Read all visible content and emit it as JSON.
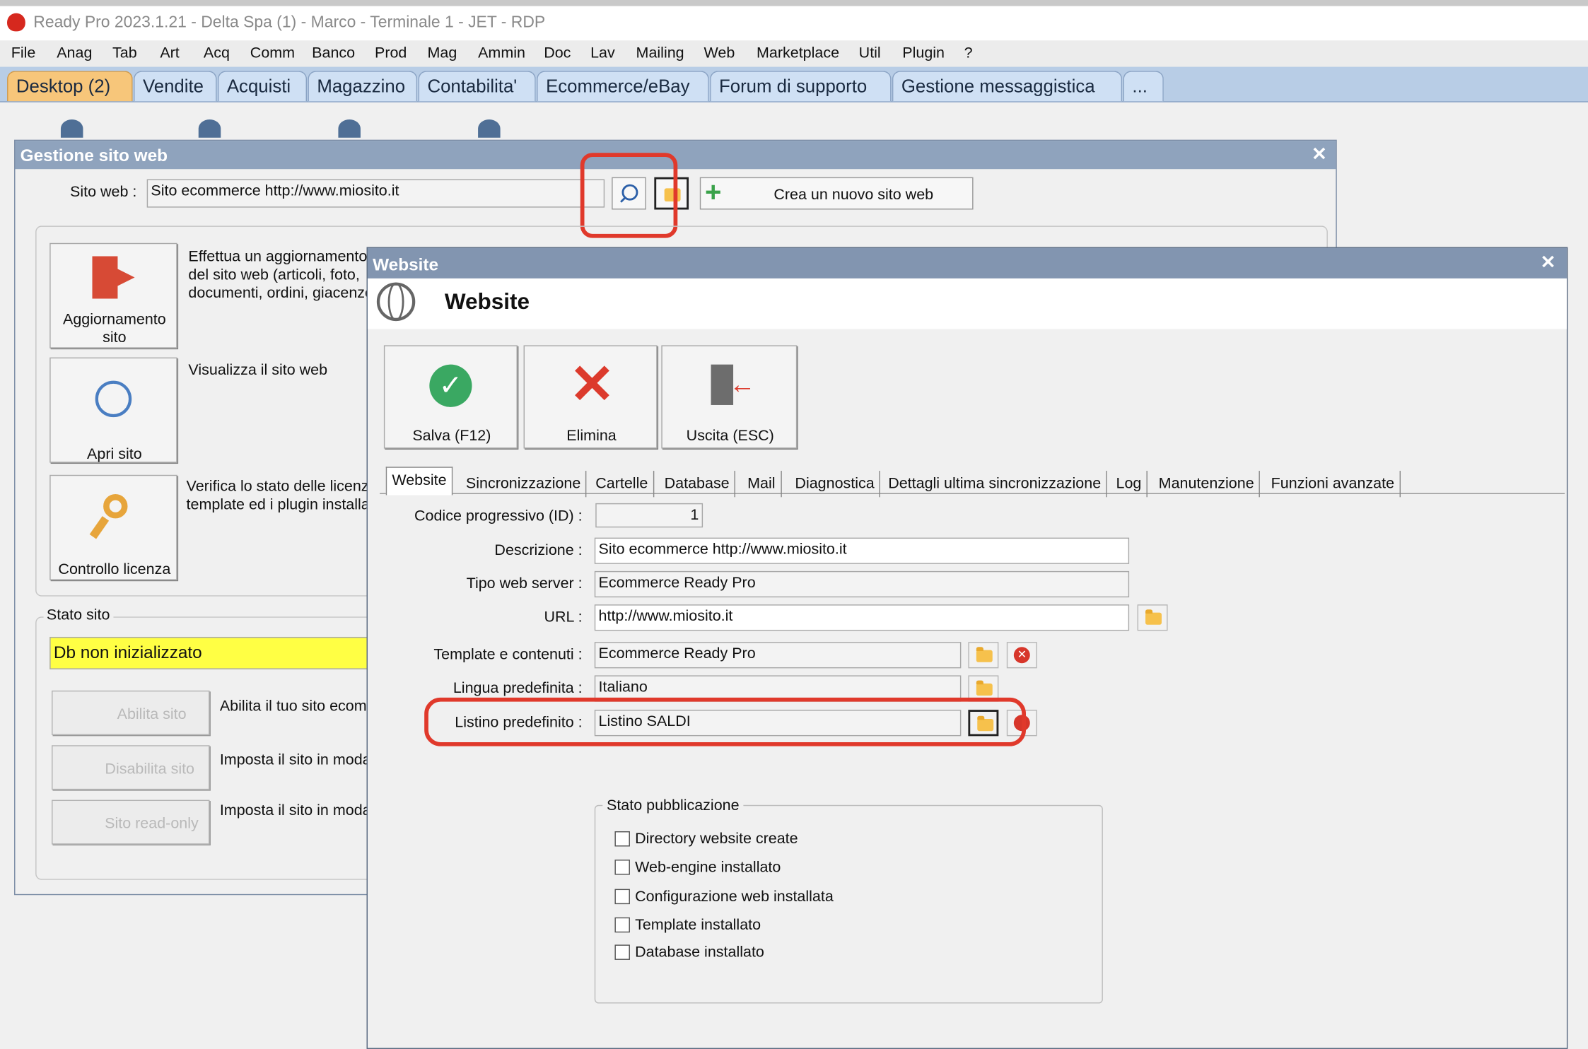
{
  "app": {
    "title": "Ready Pro 2023.1.21 - Delta Spa (1) - Marco - Terminale 1 - JET - RDP"
  },
  "menu": [
    "File",
    "Anag",
    "Tab",
    "Art",
    "Acq",
    "Comm",
    "Banco",
    "Prod",
    "Mag",
    "Ammin",
    "Doc",
    "Lav",
    "Mailing",
    "Web",
    "Marketplace",
    "Util",
    "Plugin",
    "?"
  ],
  "tabs": [
    "Desktop (2)",
    "Vendite",
    "Acquisti",
    "Magazzino",
    "Contabilita'",
    "Ecommerce/eBay",
    "Forum di supporto",
    "Gestione messaggistica",
    "..."
  ],
  "gestione": {
    "title": "Gestione sito web",
    "sito_label": "Sito web :",
    "sito_value": "Sito ecommerce http://www.miosito.it",
    "crea_label": "Crea un nuovo sito web",
    "aggiorna_label_1": "Aggiornamento",
    "aggiorna_label_2": "sito",
    "aggiorna_desc_1": "Effettua un aggiornamento",
    "aggiorna_desc_2": "del sito web (articoli, foto,",
    "aggiorna_desc_3": "documenti, ordini, giacenze",
    "apri_label": "Apri sito",
    "apri_desc": "Visualizza il sito web",
    "licenza_label": "Controllo licenza",
    "licenza_desc_1": "Verifica lo stato delle licenze",
    "licenza_desc_2": "template ed i plugin installa",
    "stato_title": "Stato sito",
    "stato_value": "Db non inizializzato",
    "abilita_label": "Abilita sito",
    "abilita_desc": "Abilita il tuo sito ecomm",
    "disabilita_label": "Disabilita sito",
    "disabilita_desc": "Imposta il sito in moda",
    "readonly_label": "Sito read-only",
    "readonly_desc": "Imposta il sito in moda"
  },
  "website": {
    "window_title": "Website",
    "header": "Website",
    "salva_label": "Salva (F12)",
    "elimina_label": "Elimina",
    "uscita_label": "Uscita (ESC)",
    "tabs": [
      "Website",
      "Sincronizzazione",
      "Cartelle",
      "Database",
      "Mail",
      "Diagnostica",
      "Dettagli ultima sincronizzazione",
      "Log",
      "Manutenzione",
      "Funzioni avanzate"
    ],
    "fields": {
      "id_label": "Codice progressivo (ID) :",
      "id_value": "1",
      "descr_label": "Descrizione :",
      "descr_value": "Sito ecommerce http://www.miosito.it",
      "server_label": "Tipo web server :",
      "server_value": "Ecommerce Ready Pro",
      "url_label": "URL :",
      "url_value": "http://www.miosito.it",
      "template_label": "Template e contenuti :",
      "template_value": "Ecommerce Ready Pro",
      "lingua_label": "Lingua predefinita :",
      "lingua_value": "Italiano",
      "listino_label": "Listino predefinito :",
      "listino_value": "Listino SALDI"
    },
    "stato_pub_title": "Stato pubblicazione",
    "checks": [
      "Directory website create",
      "Web-engine installato",
      "Configurazione web installata",
      "Template installato",
      "Database installato"
    ]
  },
  "colors": {
    "highlight": "#e0392b",
    "status_yellow": "#ffff44",
    "title_blue": "#8fa3bd"
  }
}
